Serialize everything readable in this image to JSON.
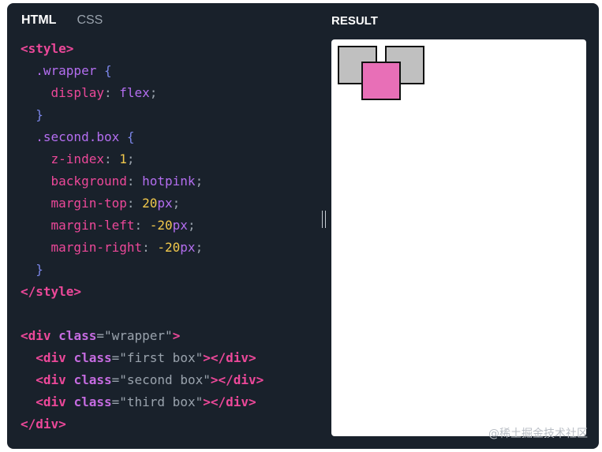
{
  "tabs": [
    {
      "label": "HTML",
      "active": true
    },
    {
      "label": "CSS",
      "active": false
    }
  ],
  "result": {
    "title": "RESULT",
    "boxes": [
      {
        "label": "first box",
        "color": "#c0c0c0"
      },
      {
        "label": "second box",
        "color": "hotpink"
      },
      {
        "label": "third box",
        "color": "#c0c0c0"
      }
    ]
  },
  "code_lines": [
    [
      {
        "t": "tag",
        "v": "<style>"
      }
    ],
    [
      {
        "t": "text",
        "v": "  "
      },
      {
        "t": "sel",
        "v": ".wrapper "
      },
      {
        "t": "brace",
        "v": "{"
      }
    ],
    [
      {
        "t": "text",
        "v": "    "
      },
      {
        "t": "prop",
        "v": "display"
      },
      {
        "t": "punct",
        "v": ": "
      },
      {
        "t": "val",
        "v": "flex"
      },
      {
        "t": "punct",
        "v": ";"
      }
    ],
    [
      {
        "t": "text",
        "v": "  "
      },
      {
        "t": "brace",
        "v": "}"
      }
    ],
    [
      {
        "t": "text",
        "v": "  "
      },
      {
        "t": "sel",
        "v": ".second.box "
      },
      {
        "t": "brace",
        "v": "{"
      }
    ],
    [
      {
        "t": "text",
        "v": "    "
      },
      {
        "t": "prop",
        "v": "z-index"
      },
      {
        "t": "punct",
        "v": ": "
      },
      {
        "t": "num",
        "v": "1"
      },
      {
        "t": "punct",
        "v": ";"
      }
    ],
    [
      {
        "t": "text",
        "v": "    "
      },
      {
        "t": "prop",
        "v": "background"
      },
      {
        "t": "punct",
        "v": ": "
      },
      {
        "t": "val",
        "v": "hotpink"
      },
      {
        "t": "punct",
        "v": ";"
      }
    ],
    [
      {
        "t": "text",
        "v": "    "
      },
      {
        "t": "prop",
        "v": "margin-top"
      },
      {
        "t": "punct",
        "v": ": "
      },
      {
        "t": "num",
        "v": "20"
      },
      {
        "t": "unit",
        "v": "px"
      },
      {
        "t": "punct",
        "v": ";"
      }
    ],
    [
      {
        "t": "text",
        "v": "    "
      },
      {
        "t": "prop",
        "v": "margin-left"
      },
      {
        "t": "punct",
        "v": ": "
      },
      {
        "t": "num",
        "v": "-20"
      },
      {
        "t": "unit",
        "v": "px"
      },
      {
        "t": "punct",
        "v": ";"
      }
    ],
    [
      {
        "t": "text",
        "v": "    "
      },
      {
        "t": "prop",
        "v": "margin-right"
      },
      {
        "t": "punct",
        "v": ": "
      },
      {
        "t": "num",
        "v": "-20"
      },
      {
        "t": "unit",
        "v": "px"
      },
      {
        "t": "punct",
        "v": ";"
      }
    ],
    [
      {
        "t": "text",
        "v": "  "
      },
      {
        "t": "brace",
        "v": "}"
      }
    ],
    [
      {
        "t": "tag",
        "v": "</style>"
      }
    ],
    [],
    [
      {
        "t": "tag",
        "v": "<div "
      },
      {
        "t": "attr",
        "v": "class"
      },
      {
        "t": "punct",
        "v": "="
      },
      {
        "t": "str",
        "v": "\"wrapper\""
      },
      {
        "t": "tag",
        "v": ">"
      }
    ],
    [
      {
        "t": "text",
        "v": "  "
      },
      {
        "t": "tag",
        "v": "<div "
      },
      {
        "t": "attr",
        "v": "class"
      },
      {
        "t": "punct",
        "v": "="
      },
      {
        "t": "str",
        "v": "\"first box\""
      },
      {
        "t": "tag",
        "v": "></div>"
      }
    ],
    [
      {
        "t": "text",
        "v": "  "
      },
      {
        "t": "tag",
        "v": "<div "
      },
      {
        "t": "attr",
        "v": "class"
      },
      {
        "t": "punct",
        "v": "="
      },
      {
        "t": "str",
        "v": "\"second box\""
      },
      {
        "t": "tag",
        "v": "></div>"
      }
    ],
    [
      {
        "t": "text",
        "v": "  "
      },
      {
        "t": "tag",
        "v": "<div "
      },
      {
        "t": "attr",
        "v": "class"
      },
      {
        "t": "punct",
        "v": "="
      },
      {
        "t": "str",
        "v": "\"third box\""
      },
      {
        "t": "tag",
        "v": "></div>"
      }
    ],
    [
      {
        "t": "tag",
        "v": "</div>"
      }
    ]
  ],
  "watermark": "@稀土掘金技术社区"
}
